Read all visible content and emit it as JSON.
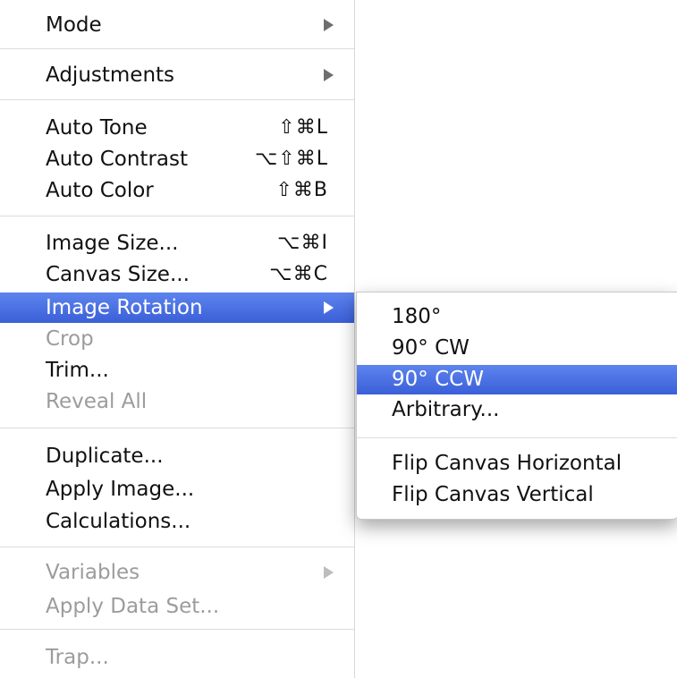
{
  "menu": {
    "mode": "Mode",
    "adjustments": "Adjustments",
    "auto_tone": {
      "label": "Auto Tone",
      "shortcut": "⇧⌘L"
    },
    "auto_contrast": {
      "label": "Auto Contrast",
      "shortcut": "⌥⇧⌘L"
    },
    "auto_color": {
      "label": "Auto Color",
      "shortcut": "⇧⌘B"
    },
    "image_size": {
      "label": "Image Size...",
      "shortcut": "⌥⌘I"
    },
    "canvas_size": {
      "label": "Canvas Size...",
      "shortcut": "⌥⌘C"
    },
    "image_rotation": "Image Rotation",
    "crop": "Crop",
    "trim": "Trim...",
    "reveal_all": "Reveal All",
    "duplicate": "Duplicate...",
    "apply_image": "Apply Image...",
    "calculations": "Calculations...",
    "variables": "Variables",
    "apply_data_set": "Apply Data Set...",
    "trap": "Trap..."
  },
  "submenu": {
    "rotate_180": "180°",
    "rotate_90_cw": "90° CW",
    "rotate_90_ccw": "90° CCW",
    "arbitrary": "Arbitrary...",
    "flip_horizontal": "Flip Canvas Horizontal",
    "flip_vertical": "Flip Canvas Vertical"
  },
  "colors": {
    "highlight": "#3d62dc",
    "disabled_text": "#9c9c9c",
    "text": "#111111"
  }
}
